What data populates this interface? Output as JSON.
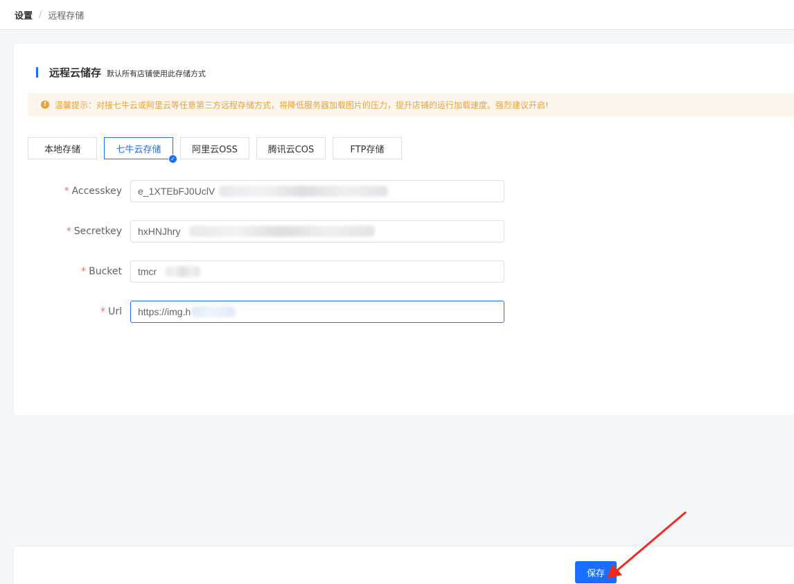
{
  "breadcrumb": {
    "first": "设置",
    "separator": "/",
    "current": "远程存储"
  },
  "card": {
    "title": "远程云储存",
    "subtitle": "默认所有店铺使用此存储方式"
  },
  "tip": {
    "icon": "!",
    "text": "温馨提示：对接七牛云或阿里云等任意第三方远程存储方式，将降低服务器加载图片的压力，提升店铺的运行加载速度。强烈建议开启!"
  },
  "tabs": [
    {
      "label": "本地存储",
      "active": false
    },
    {
      "label": "七牛云存储",
      "active": true
    },
    {
      "label": "阿里云OSS",
      "active": false
    },
    {
      "label": "腾讯云COS",
      "active": false
    },
    {
      "label": "FTP存储",
      "active": false
    }
  ],
  "form": {
    "required_mark": "*",
    "fields": [
      {
        "label": "Accesskey",
        "value": "e_1XTEbFJ0UclV"
      },
      {
        "label": "Secretkey",
        "value": "hxHNJhry"
      },
      {
        "label": "Bucket",
        "value": "tmcr"
      },
      {
        "label": "Url",
        "value": "https://img.h"
      }
    ]
  },
  "footer": {
    "save_label": "保存"
  },
  "colors": {
    "primary": "#1a6eff",
    "warning": "#e6a23c",
    "required": "#f56c6c",
    "annotation": "#f02a1a"
  }
}
